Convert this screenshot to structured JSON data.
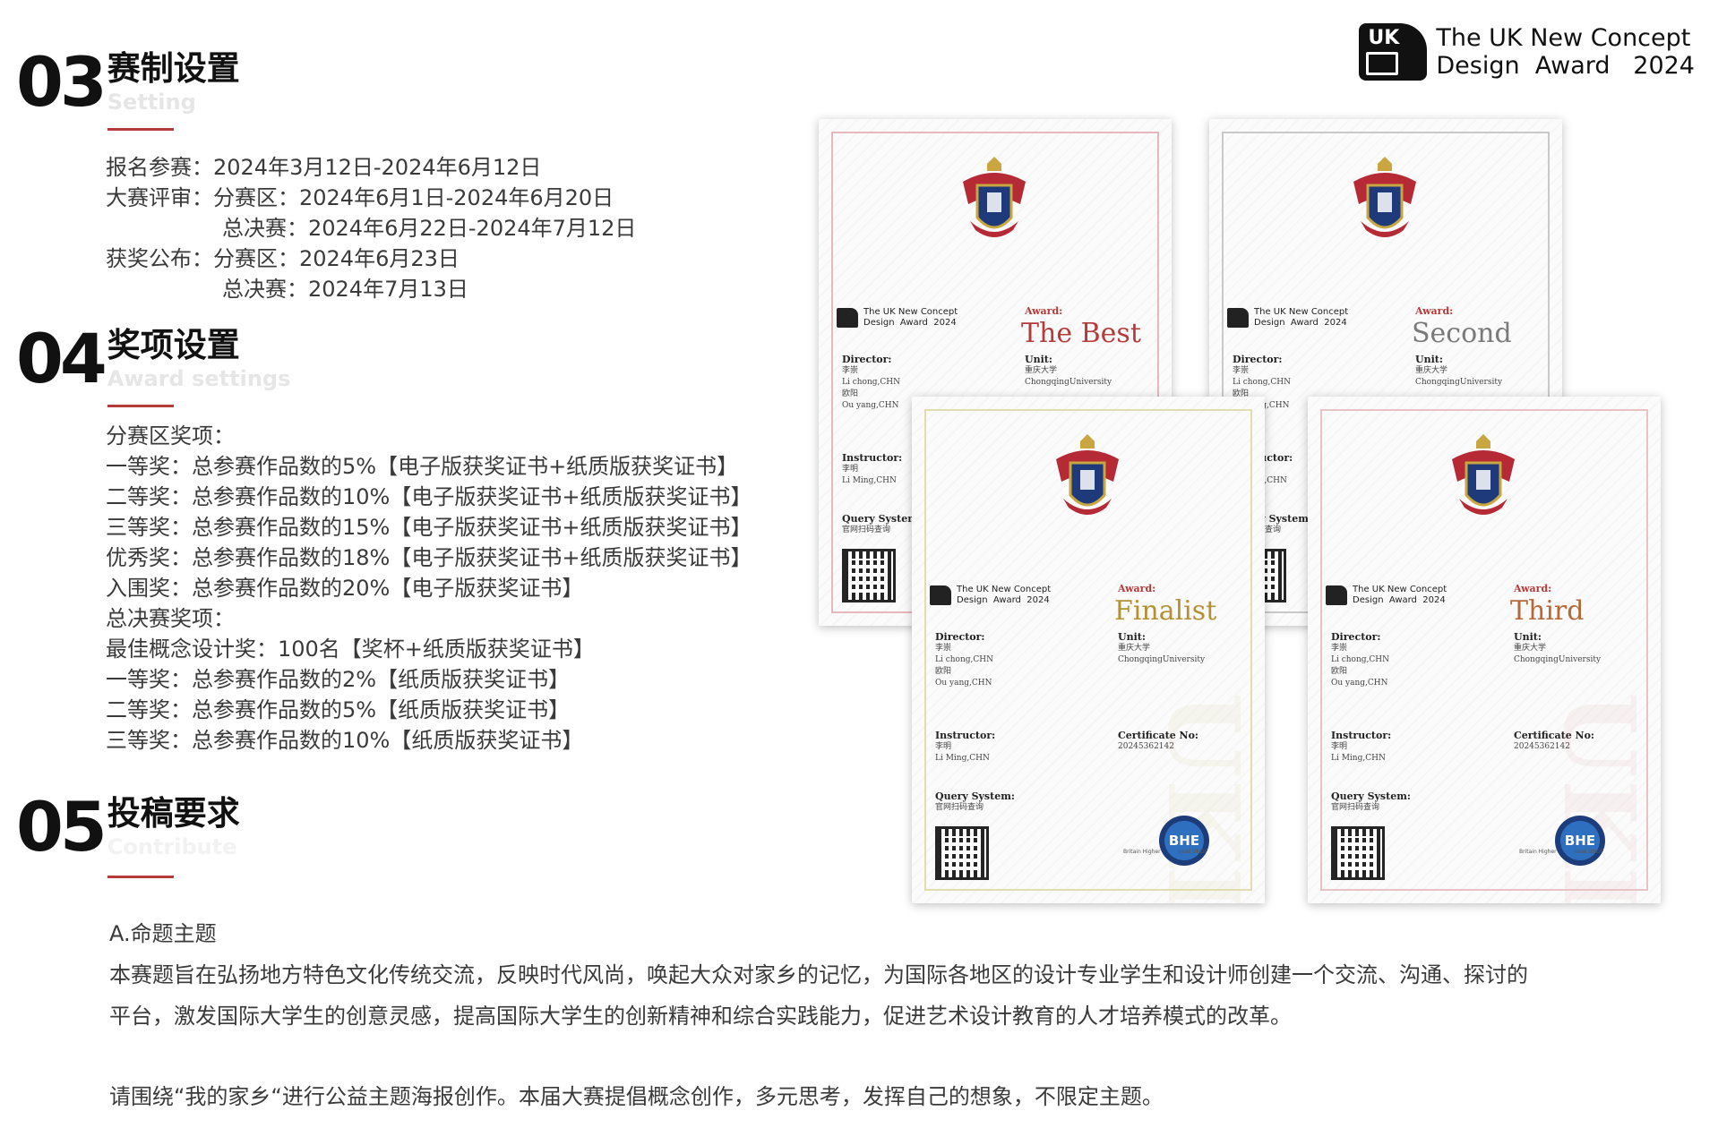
{
  "brand": {
    "logo_mark_top": "UK",
    "line1": "The UK New Concept",
    "line2": "Design  Award   2024"
  },
  "sections": [
    {
      "number": "03",
      "title_cn": "赛制设置",
      "title_en": "Setting",
      "lines": [
        "报名参赛：2024年3月12日-2024年6月12日",
        "大赛评审：分赛区：2024年6月1日-2024年6月20日",
        "总决赛：2024年6月22日-2024年7月12日",
        "获奖公布：分赛区：2024年6月23日",
        "总决赛：2024年7月13日"
      ]
    },
    {
      "number": "04",
      "title_cn": "奖项设置",
      "title_en": "Award settings",
      "lines": [
        "分赛区奖项：",
        "一等奖：总参赛作品数的5%【电子版获奖证书+纸质版获奖证书】",
        "二等奖：总参赛作品数的10%【电子版获奖证书+纸质版获奖证书】",
        "三等奖：总参赛作品数的15%【电子版获奖证书+纸质版获奖证书】",
        "优秀奖：总参赛作品数的18%【电子版获奖证书+纸质版获奖证书】",
        "入围奖：总参赛作品数的20%【电子版获奖证书】",
        "总决赛奖项：",
        "最佳概念设计奖：100名【奖杯+纸质版获奖证书】",
        "一等奖：总参赛作品数的2%【纸质版获奖证书】",
        "二等奖：总参赛作品数的5%【纸质版获奖证书】",
        "三等奖：总参赛作品数的10%【纸质版获奖证书】"
      ]
    },
    {
      "number": "05",
      "title_cn": "投稿要求",
      "title_en": "Contribute",
      "subhead": "A.命题主题",
      "para1": "本赛题旨在弘扬地方特色文化传统交流，反映时代风尚，唤起大众对家乡的记忆，为国际各地区的设计专业学生和设计师创建一个交流、沟通、探讨的",
      "para1b": "平台，激发国际大学生的创意灵感，提高国际大学生的创新精神和综合实践能力，促进艺术设计教育的人才培养模式的改革。",
      "para2": "请围绕“我的家乡“进行公益主题海报创作。本届大赛提倡概念创作，多元思考，发挥自己的想象，不限定主题。"
    }
  ],
  "certificate_common": {
    "logo_line1": "The UK New Concept",
    "logo_line2": "Design  Award  2024",
    "award_label": "Award:",
    "director_label": "Director:",
    "director_cn": "李崇",
    "director_en": "Li chong,CHN",
    "director2_cn": "欧阳",
    "director2_en": "Ou yang,CHN",
    "unit_label": "Unit:",
    "unit_cn": "重庆大学",
    "unit_en": "ChongqingUniversity",
    "instructor_label": "Instructor:",
    "instructor_cn": "李明",
    "instructor_en": "Li Ming,CHN",
    "query_label": "Query System:",
    "query_sub": "官网扫码查询",
    "cert_no_label": "Certificate No:",
    "cert_no": "20245362142",
    "seal_text": "BHE",
    "seal_caption": "Britain Higher          ional UNDP",
    "watermark": "UKDA"
  },
  "certificates": [
    {
      "award": "The Best",
      "color": "#b63a3a",
      "border": "#e8b7bd"
    },
    {
      "award": "Second",
      "color": "#7a7a7a",
      "border": "#c9c9c9"
    },
    {
      "award": "Finalist",
      "color": "#b39032",
      "border": "#e2dcb0"
    },
    {
      "award": "Third",
      "color": "#b4693b",
      "border": "#e8c3c3"
    }
  ]
}
